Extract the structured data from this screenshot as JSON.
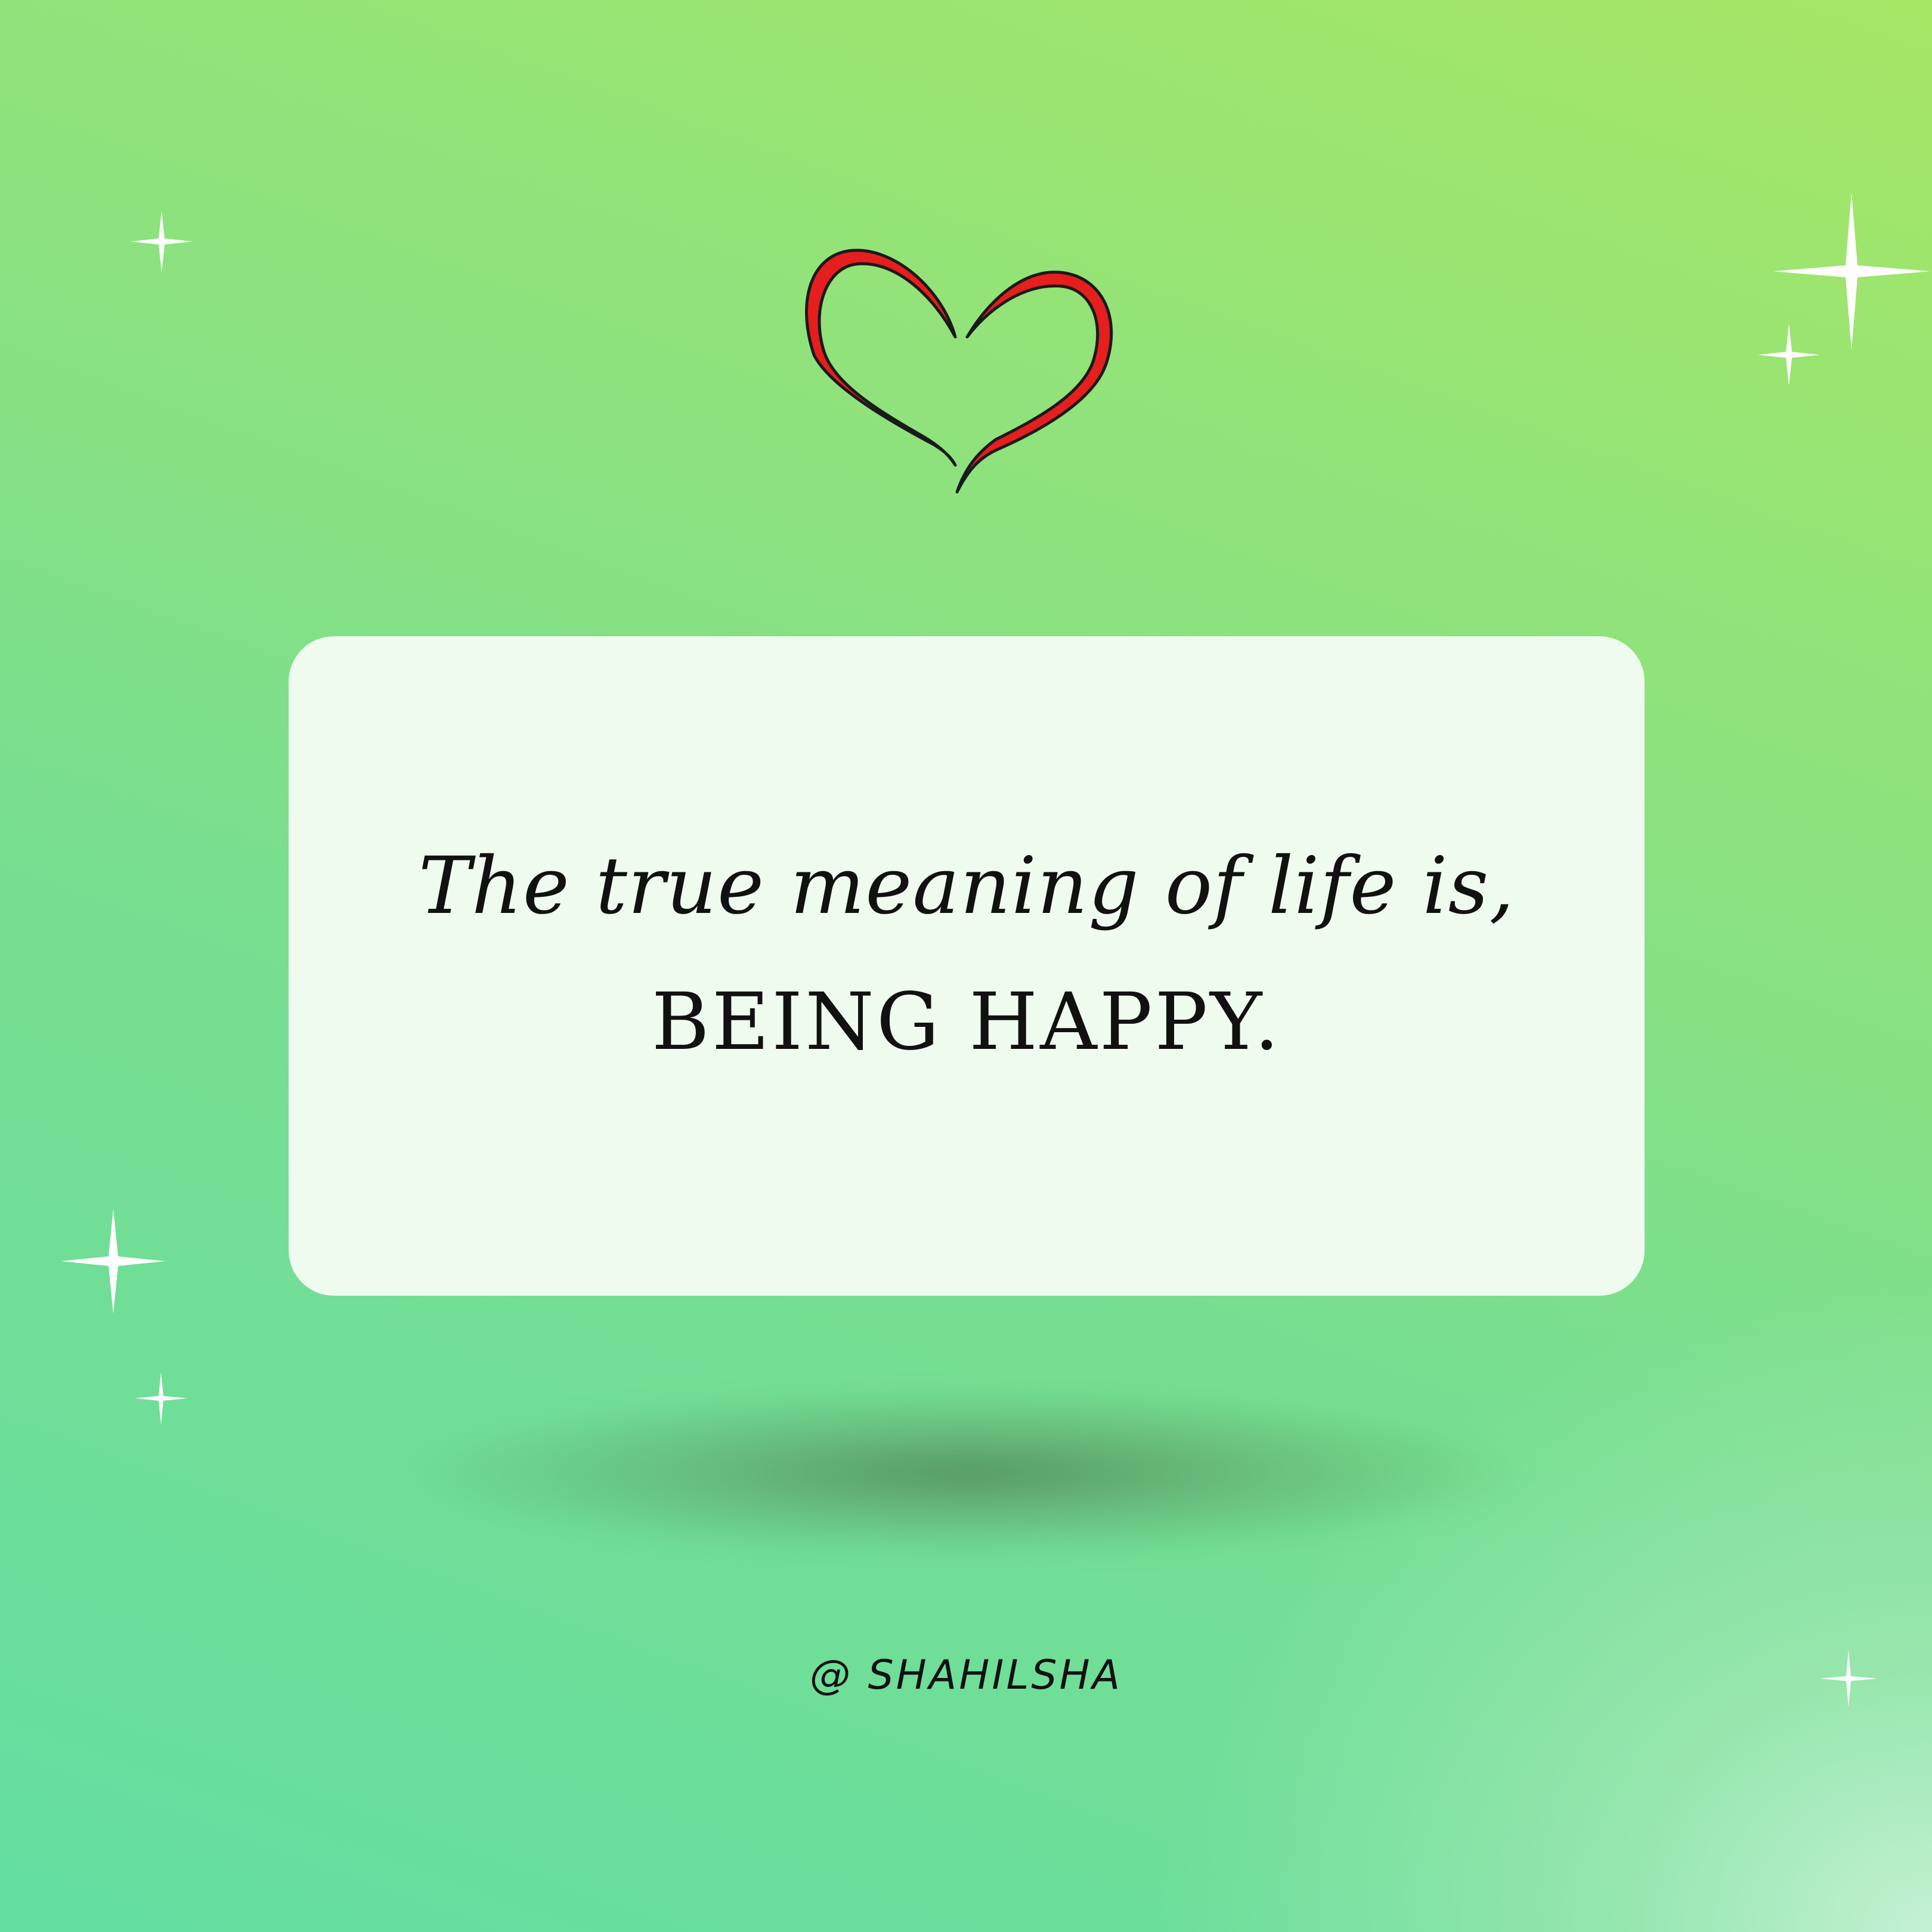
{
  "quote": {
    "line1": "The true meaning of life is,",
    "line2": "BEING HAPPY."
  },
  "footer": {
    "handle": "@ SHAHILSHA"
  },
  "icons": {
    "heart": "heart-outline-icon",
    "sparkle": "sparkle-icon"
  },
  "colors": {
    "background_top": "#a6e766",
    "background_bottom": "#64dea2",
    "card": "#f0fbef",
    "heart": "#e51e1e",
    "text": "#111111"
  }
}
